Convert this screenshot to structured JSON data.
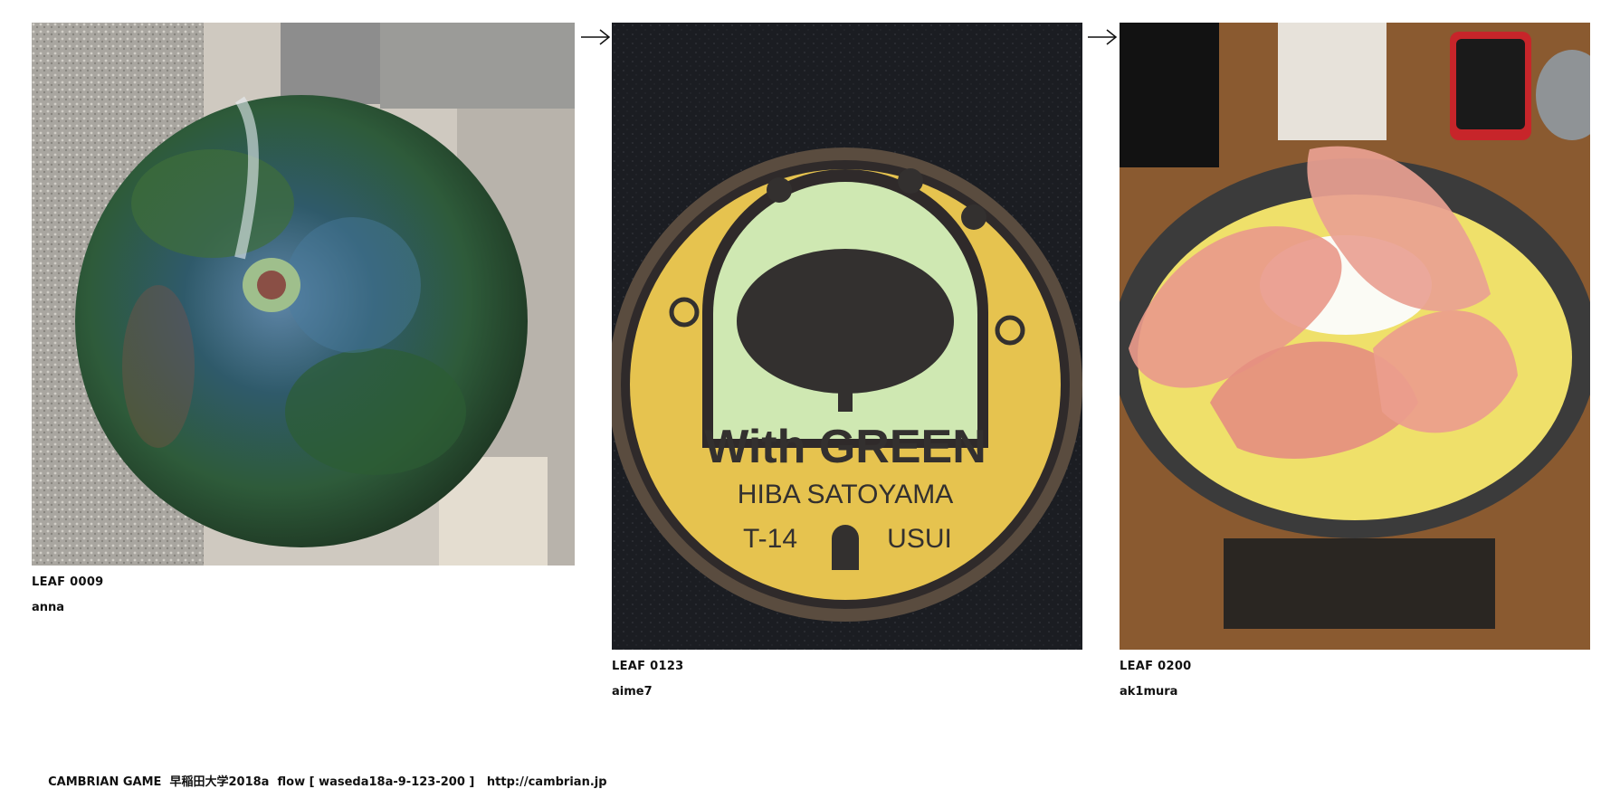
{
  "leaves": [
    {
      "label": "LEAF 0009",
      "user": "anna",
      "image": "green-glazed-ceramic-ball-photo"
    },
    {
      "label": "LEAF 0123",
      "user": "aime7",
      "image": "manhole-cover-photo",
      "manhole": {
        "line1": "With GREEN",
        "line2": "HIBA SATOYAMA",
        "left": "T-14",
        "right": "USUI"
      }
    },
    {
      "label": "LEAF 0200",
      "user": "ak1mura",
      "image": "prosciutto-rice-bowl-photo"
    }
  ],
  "arrows": [
    "arrow-right-icon",
    "arrow-right-icon"
  ],
  "footer": {
    "game": "CAMBRIAN GAME",
    "course": "早稲田大学2018a",
    "flow": "flow [ waseda18a-9-123-200 ]",
    "url": "http://cambrian.jp"
  }
}
